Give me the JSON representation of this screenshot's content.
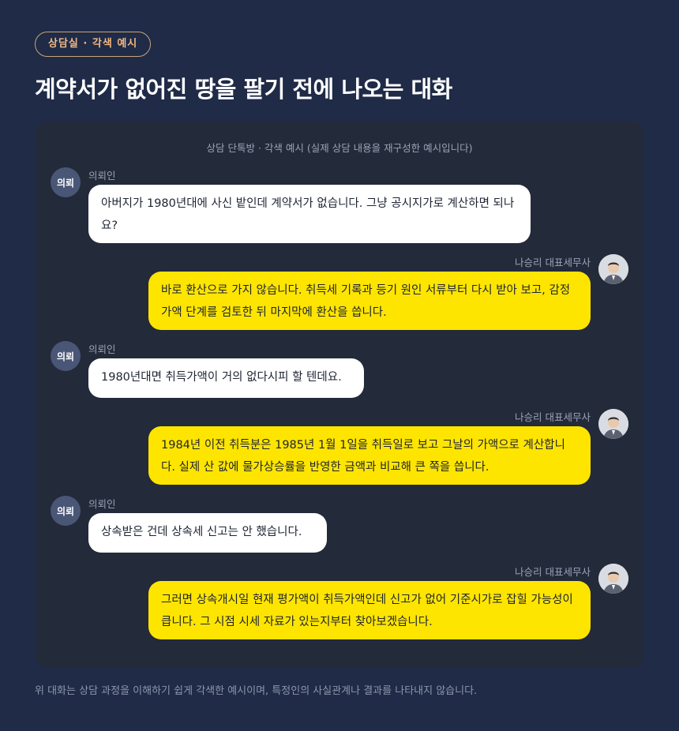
{
  "badge": "상담실 · 각색 예시",
  "title": "계약서가 없어진 땅을 팔기 전에 나오는 대화",
  "panel_caption": "상담 단톡방 · 각색 예시 (실제 상담 내용을 재구성한 예시입니다)",
  "client": {
    "avatar_text": "의뢰",
    "name": "의뢰인"
  },
  "advisor": {
    "name": "나승리 대표세무사",
    "avatar_icon": "advisor-photo"
  },
  "messages": [
    {
      "from": "client",
      "text": "아버지가 1980년대에 사신 밭인데 계약서가 없습니다. 그냥 공시지가로 계산하면 되나요?"
    },
    {
      "from": "advisor",
      "text": "바로 환산으로 가지 않습니다. 취득세 기록과 등기 원인 서류부터 다시 받아 보고, 감정가액 단계를 검토한 뒤 마지막에 환산을 씁니다."
    },
    {
      "from": "client",
      "text": "1980년대면 취득가액이 거의 없다시피 할 텐데요."
    },
    {
      "from": "advisor",
      "text": "1984년 이전 취득분은 1985년 1월 1일을 취득일로 보고 그날의 가액으로 계산합니다. 실제 산 값에 물가상승률을 반영한 금액과 비교해 큰 쪽을 씁니다."
    },
    {
      "from": "client",
      "text": "상속받은 건데 상속세 신고는 안 했습니다."
    },
    {
      "from": "advisor",
      "text": "그러면 상속개시일 현재 평가액이 취득가액인데 신고가 없어 기준시가로 잡힐 가능성이 큽니다. 그 시점 시세 자료가 있는지부터 찾아보겠습니다."
    }
  ],
  "footer": "위 대화는 상담 과정을 이해하기 쉽게 각색한 예시이며, 특정인의 사실관계나 결과를 나타내지 않습니다.",
  "colors": {
    "background": "#1f2b47",
    "panel": "#232a3a",
    "advisor_bubble": "#fee500",
    "client_bubble": "#ffffff",
    "badge_text": "#f0b884"
  }
}
